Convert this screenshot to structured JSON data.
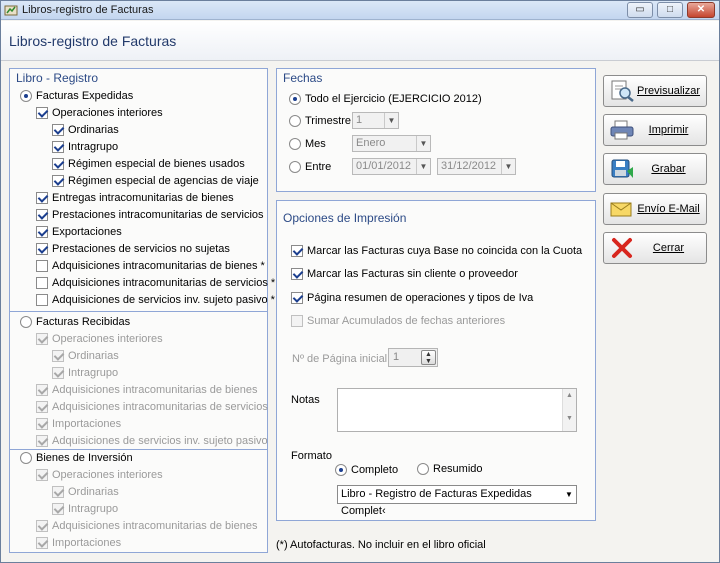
{
  "window": {
    "title": "Libros-registro de Facturas",
    "heading": "Libros-registro de Facturas",
    "controls": {
      "minimize": "▭",
      "maximize": "□",
      "close": "✕"
    }
  },
  "libro": {
    "title": "Libro - Registro",
    "expedidas": {
      "label": "Facturas Expedidas",
      "items": [
        {
          "label": "Operaciones interiores",
          "checked": true
        },
        {
          "label": "Ordinarias",
          "checked": true
        },
        {
          "label": "Intragrupo",
          "checked": true
        },
        {
          "label": "Régimen especial de bienes usados",
          "checked": true
        },
        {
          "label": "Régimen especial de agencias de viaje",
          "checked": true
        },
        {
          "label": "Entregas intracomunitarias de bienes",
          "checked": true
        },
        {
          "label": "Prestaciones intracomunitarias de servicios",
          "checked": true
        },
        {
          "label": "Exportaciones",
          "checked": true
        },
        {
          "label": "Prestaciones de servicios no sujetas",
          "checked": true
        },
        {
          "label": "Adquisiciones intracomunitarias de bienes *",
          "checked": false
        },
        {
          "label": "Adquisiciones intracomunitarias de servicios *",
          "checked": false
        },
        {
          "label": "Adquisiciones de servicios inv. sujeto pasivo *",
          "checked": false
        }
      ]
    },
    "recibidas": {
      "label": "Facturas Recibidas",
      "items": [
        {
          "label": "Operaciones interiores",
          "checked": true
        },
        {
          "label": "Ordinarias",
          "checked": true
        },
        {
          "label": "Intragrupo",
          "checked": true
        },
        {
          "label": "Adquisiciones intracomunitarias de bienes",
          "checked": true
        },
        {
          "label": "Adquisiciones intracomunitarias de servicios",
          "checked": true
        },
        {
          "label": "Importaciones",
          "checked": true
        },
        {
          "label": "Adquisiciones de servicios inv. sujeto pasivo",
          "checked": true
        }
      ]
    },
    "inversion": {
      "label": "Bienes de Inversión",
      "items": [
        {
          "label": "Operaciones interiores",
          "checked": true
        },
        {
          "label": "Ordinarias",
          "checked": true
        },
        {
          "label": "Intragrupo",
          "checked": true
        },
        {
          "label": "Adquisiciones intracomunitarias de bienes",
          "checked": true
        },
        {
          "label": "Importaciones",
          "checked": true
        }
      ]
    }
  },
  "fechas": {
    "title": "Fechas",
    "todo_label": "Todo el Ejercicio (EJERCICIO 2012)",
    "trimestre_label": "Trimestre",
    "trimestre_value": "1",
    "mes_label": "Mes",
    "mes_value": "Enero",
    "entre_label": "Entre",
    "date_from": "01/01/2012",
    "date_to": "31/12/2012"
  },
  "opciones": {
    "title": "Opciones de Impresión",
    "marcar_base": "Marcar las Facturas cuya Base no coincida con la Cuota",
    "marcar_sin_cliente": "Marcar las Facturas sin cliente o proveedor",
    "pagina_resumen": "Página resumen de operaciones y tipos de Iva",
    "sumar_acumulados": "Sumar Acumulados de fechas anteriores",
    "pagina_inicial_label": "Nº de Página inicial",
    "pagina_inicial_value": "1",
    "notas_label": "Notas",
    "notas_value": "",
    "formato_label": "Formato",
    "completo_label": "Completo",
    "resumido_label": "Resumido",
    "formato_value": "Libro - Registro de Facturas Expedidas Complet‹"
  },
  "buttons": {
    "previsualizar": "Previsualizar",
    "imprimir": "Imprimir",
    "grabar": "Grabar",
    "envio": "Envío E-Mail",
    "cerrar": "Cerrar"
  },
  "footnote": "(*) Autofacturas. No incluir en el libro oficial"
}
